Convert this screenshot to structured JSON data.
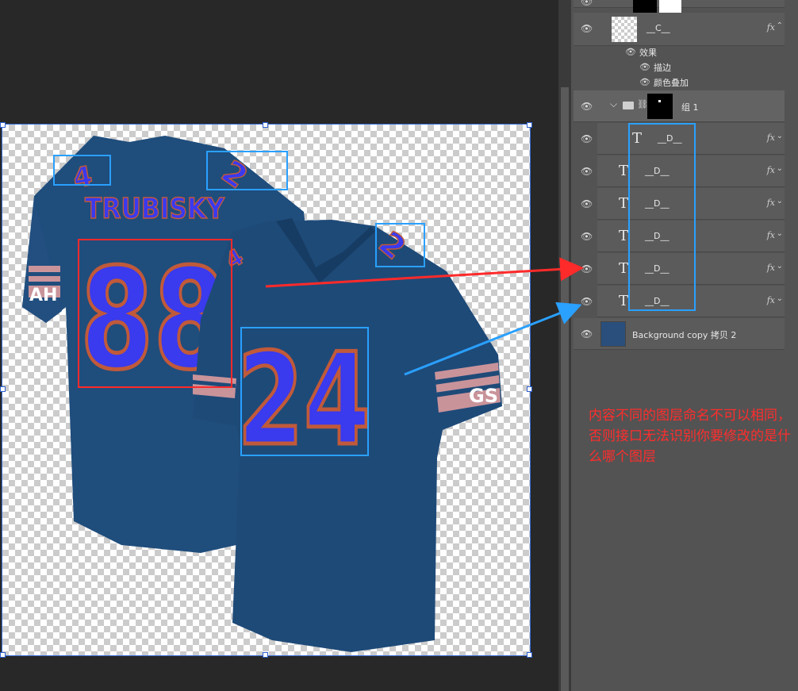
{
  "canvas": {
    "back_jersey": {
      "name_text": "TRUBISKY",
      "number": "88",
      "shoulder_number_left": "4",
      "shoulder_number_right": "2",
      "sleeve_text": "AH"
    },
    "front_jersey": {
      "number": "24",
      "shoulder_number": "2",
      "shoulder_number_left": "4",
      "sleeve_text": "GS"
    },
    "colors": {
      "jersey": "#1e4a78",
      "number_fill": "#3a3aee",
      "number_outline": "#c05a3a",
      "red_box": "#ff2a2a",
      "blue_box": "#2aa0ff"
    }
  },
  "layers": {
    "top_partial": {
      "eye": "👁"
    },
    "layer_c": {
      "eye": "👁",
      "name": "__C__",
      "fx": "fx"
    },
    "effects": {
      "label": "效果",
      "stroke": "描边",
      "color_overlay": "颜色叠加"
    },
    "group1": {
      "eye": "👁",
      "name": "组 1",
      "chevron": "⌵"
    },
    "text_layers": [
      {
        "eye": "👁",
        "t": "T",
        "name": "__D__",
        "fx": "fx"
      },
      {
        "eye": "👁",
        "t": "T",
        "name": "__D__",
        "fx": "fx"
      },
      {
        "eye": "👁",
        "t": "T",
        "name": "__D__",
        "fx": "fx"
      },
      {
        "eye": "👁",
        "t": "T",
        "name": "__D__",
        "fx": "fx"
      },
      {
        "eye": "👁",
        "t": "T",
        "name": "__D__",
        "fx": "fx"
      },
      {
        "eye": "👁",
        "t": "T",
        "name": "__D__",
        "fx": "fx"
      }
    ],
    "background": {
      "eye": "👁",
      "name": "Background copy 拷贝 2"
    }
  },
  "note": "内容不同的图层命名不可以相同，否则接口无法识别你要修改的是什么哪个图层"
}
